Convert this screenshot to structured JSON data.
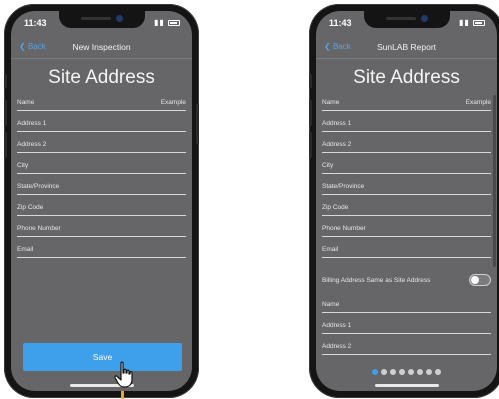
{
  "left_phone": {
    "status": {
      "time": "11:43"
    },
    "navbar": {
      "back": "Back",
      "title": "New Inspection"
    },
    "page_title": "Site Address",
    "fields": [
      {
        "label": "Name",
        "value": "Example"
      },
      {
        "label": "Address 1",
        "value": ""
      },
      {
        "label": "Address 2",
        "value": ""
      },
      {
        "label": "City",
        "value": ""
      },
      {
        "label": "State/Province",
        "value": ""
      },
      {
        "label": "Zip Code",
        "value": ""
      },
      {
        "label": "Phone Number",
        "value": ""
      },
      {
        "label": "Email",
        "value": ""
      }
    ],
    "save_label": "Save"
  },
  "right_phone": {
    "status": {
      "time": "11:43"
    },
    "navbar": {
      "back": "Back",
      "title": "SunLAB Report"
    },
    "page_title": "Site Address",
    "fields": [
      {
        "label": "Name",
        "value": "Example"
      },
      {
        "label": "Address 1",
        "value": ""
      },
      {
        "label": "Address 2",
        "value": ""
      },
      {
        "label": "City",
        "value": ""
      },
      {
        "label": "State/Province",
        "value": ""
      },
      {
        "label": "Zip Code",
        "value": ""
      },
      {
        "label": "Phone Number",
        "value": ""
      },
      {
        "label": "Email",
        "value": ""
      }
    ],
    "billing_toggle": {
      "label": "Billing Address Same as Site Address",
      "on": false
    },
    "billing_fields": [
      {
        "label": "Name"
      },
      {
        "label": "Address 1"
      },
      {
        "label": "Address 2"
      }
    ],
    "page_dots": {
      "count": 8,
      "active_index": 0
    }
  },
  "colors": {
    "accent": "#3ea0ea",
    "screen_bg": "#666668",
    "cursor_marker": "#f3a12c"
  }
}
